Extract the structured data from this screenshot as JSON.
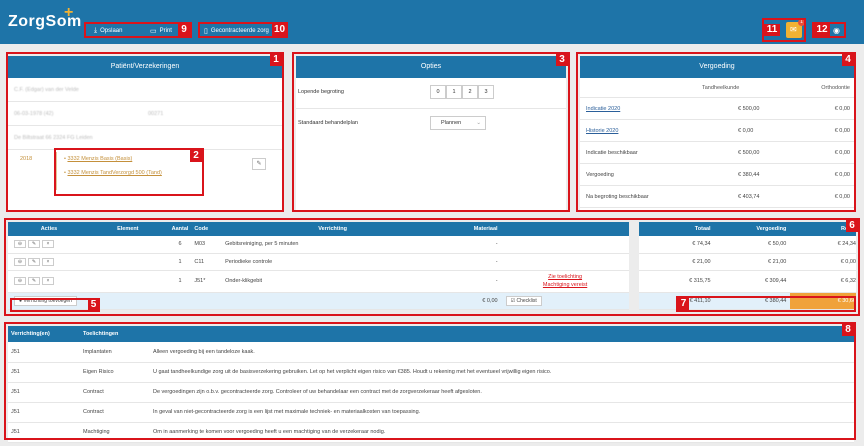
{
  "app": {
    "logo_text": "ZorgSom",
    "logo_plus": "+"
  },
  "toolbar": {
    "save_label": "Opslaan",
    "save_icon": "download-icon",
    "print_label": "Print",
    "print_icon": "printer-icon",
    "contracted_label": "Gecontracteerde zorg",
    "contracted_icon": "document-icon",
    "notifications_icon": "envelope-icon",
    "notifications_count": "1",
    "settings_icon": "settings-icon"
  },
  "markers": [
    "1",
    "2",
    "3",
    "4",
    "5",
    "6",
    "7",
    "8",
    "9",
    "10",
    "11",
    "12"
  ],
  "patient": {
    "title": "Patiënt/Verzekeringen",
    "name": "C.F. (Edgar) van der Velde",
    "birth": "06-03-1978 (42)",
    "code": "00271",
    "address": "De Biltstraat 66 2324 FG Leiden",
    "year": "2018",
    "insurances": [
      "3332 Menzis Basis (Basis)",
      "3332 Menzis TandVerzorgd 500 (Tand)"
    ],
    "edit_icon": "pencil-icon"
  },
  "options": {
    "title": "Opties",
    "running_label": "Lopende begroting",
    "running_values": [
      "0",
      "1",
      "2",
      "3"
    ],
    "plan_label": "Standaard behandelplan",
    "plan_value": "Plannen"
  },
  "reimbursement": {
    "title": "Vergoeding",
    "col1": "Tandheelkunde",
    "col2": "Orthodontie",
    "rows": [
      {
        "label": "Indicatie 2020",
        "link": true,
        "v1": "€ 500,00",
        "v2": "€ 0,00"
      },
      {
        "label": "Historie 2020",
        "link": true,
        "v1": "€ 0,00",
        "v2": "€ 0,00"
      },
      {
        "label": "Indicatie beschikbaar",
        "link": false,
        "v1": "€ 500,00",
        "v2": "€ 0,00"
      },
      {
        "label": "Vergoeding",
        "link": false,
        "v1": "€ 380,44",
        "v2": "€ 0,00"
      },
      {
        "label": "Na begroting beschikbaar",
        "link": false,
        "v1": "€ 403,74",
        "v2": "€ 0,00"
      }
    ]
  },
  "treatments": {
    "headers": {
      "actions": "Acties",
      "element": "Element",
      "amount": "Aantal",
      "code": "Code",
      "treatment": "Verrichting",
      "material": "Materiaal",
      "total": "Totaal",
      "reimbursement": "Vergoeding",
      "rest": "Resta"
    },
    "rows": [
      {
        "amount": "6",
        "code": "M03",
        "treatment": "Gebitsreiniging, per 5 minuten",
        "material": "-",
        "note1": "",
        "note2": "",
        "total": "€ 74,34",
        "reimb": "€ 50,00",
        "rest": "€ 24,34"
      },
      {
        "amount": "1",
        "code": "C11",
        "treatment": "Periodieke controle",
        "material": "-",
        "note1": "",
        "note2": "",
        "total": "€ 21,00",
        "reimb": "€ 21,00",
        "rest": "€ 0,00"
      },
      {
        "amount": "1",
        "code": "J51*",
        "treatment": "Onder-klikgebit",
        "material": "-",
        "note1": "Zie toelichting",
        "note2": "Machtiging vereist",
        "total": "€ 315,75",
        "reimb": "€ 309,44",
        "rest": "€ 6,32"
      }
    ],
    "add_label": "Verrichting toevoegen",
    "material_total": "€ 0,00",
    "checklist_label": "Checklist",
    "sum_total": "€ 411,10",
    "sum_reimb": "€ 380,44",
    "sum_rest": "€ 30,66",
    "btn_icons": [
      "minus-circle-icon",
      "pencil-icon",
      "close-icon"
    ]
  },
  "explanations": {
    "header1": "Verrichting(en)",
    "header2": "Toelichtingen",
    "rows": [
      {
        "code": "J51",
        "topic": "Implantaten",
        "text": "Alleen vergoeding bij een tandeloze kaak."
      },
      {
        "code": "J51",
        "topic": "Eigen Risico",
        "text": "U gaat tandheelkundige zorg uit de basisverzekering gebruiken. Let op het verplicht eigen risico van €385. Houdt u rekening met het eventueel vrijwillig eigen risico."
      },
      {
        "code": "J51",
        "topic": "Contract",
        "text": "De vergoedingen zijn o.b.v. gecontracteerde zorg. Controleer of uw behandelaar een contract met de zorgverzekeraar heeft afgesloten."
      },
      {
        "code": "J51",
        "topic": "Contract",
        "text": "In geval van niet-gecontracteerde zorg is een lijst met maximale techniek- en materiaalkosten van toepassing."
      },
      {
        "code": "J51",
        "topic": "Machtiging",
        "text": "Om in aanmerking te komen voor vergoeding heeft u een machtiging van de verzekeraar nodig."
      }
    ]
  },
  "colors": {
    "primary": "#1e74a8",
    "highlight": "#d9141b",
    "accent": "#f2b233",
    "rest_highlight": "#f0a23a"
  }
}
